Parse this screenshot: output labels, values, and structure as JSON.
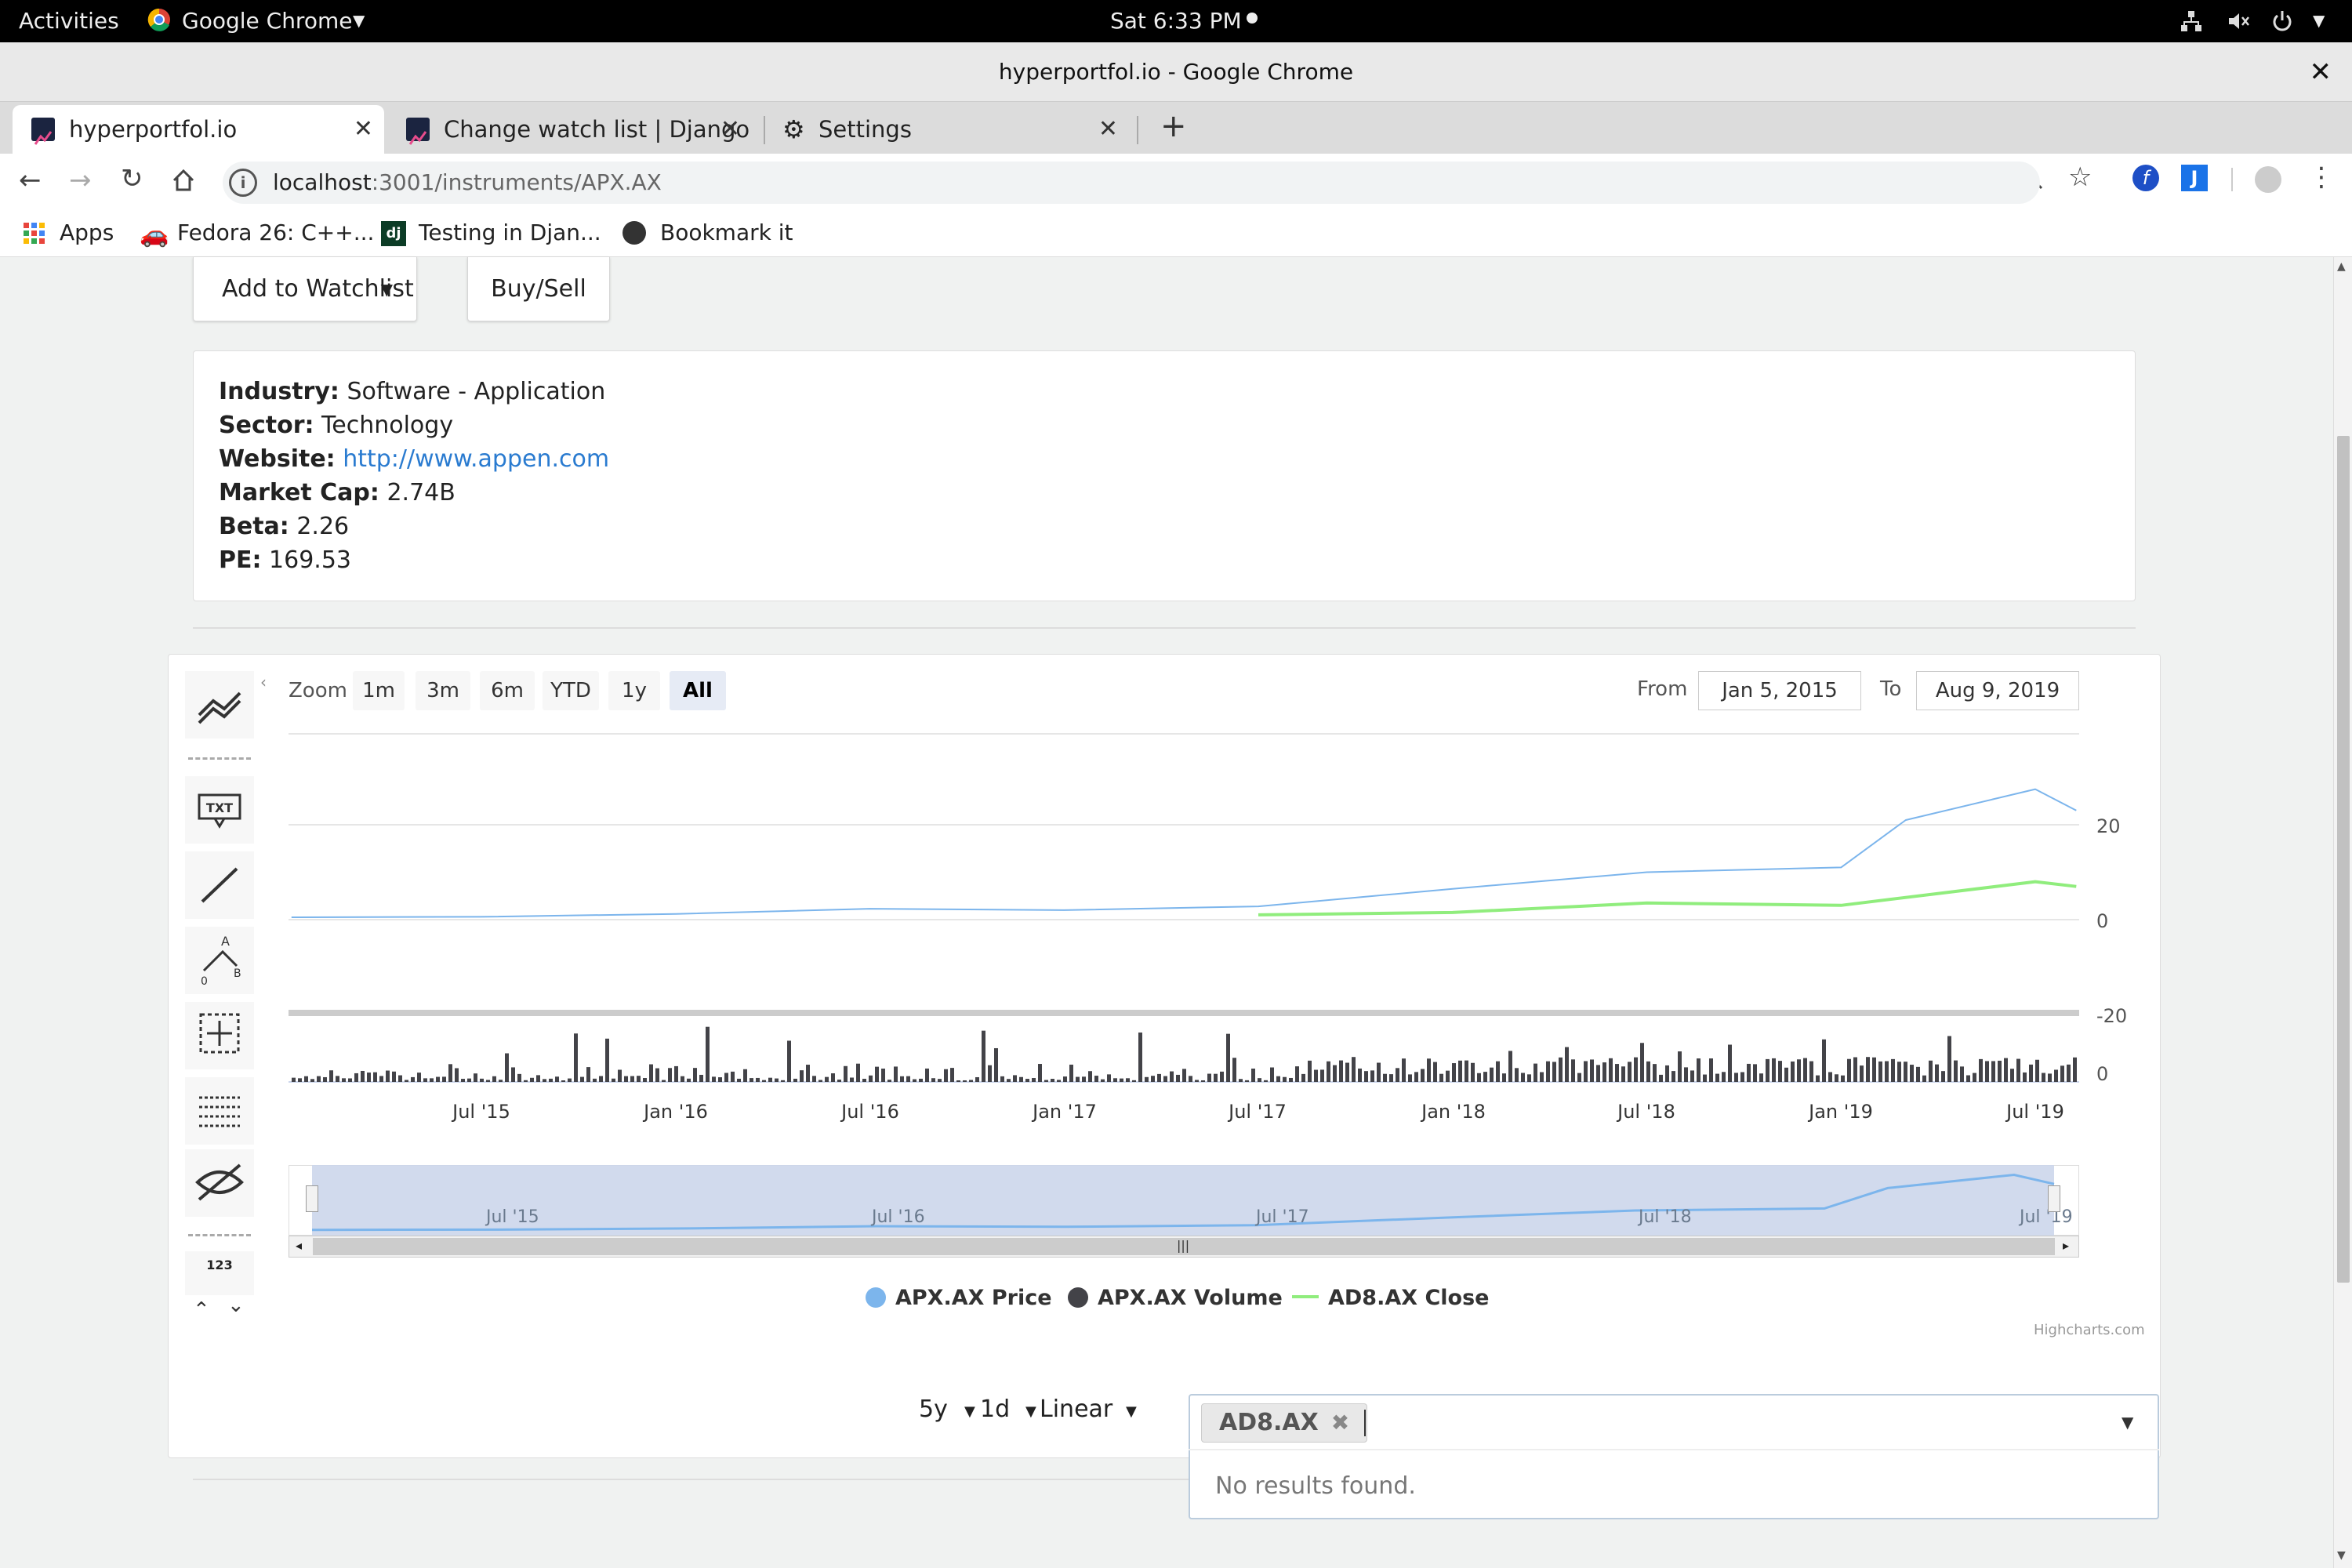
{
  "system_bar": {
    "activities": "Activities",
    "app_name": "Google Chrome",
    "clock": "Sat  6:33 PM"
  },
  "window": {
    "title": "hyperportfol.io - Google Chrome"
  },
  "tabs": [
    {
      "label": "hyperportfol.io"
    },
    {
      "label": "Change watch list | Django"
    },
    {
      "label": "Settings"
    }
  ],
  "address": {
    "host": "localhost",
    "path": ":3001/instruments/APX.AX"
  },
  "bookmarks": [
    {
      "label": "Apps"
    },
    {
      "label": "Fedora 26: C++..."
    },
    {
      "label": "Testing in Djan..."
    },
    {
      "label": "Bookmark it"
    }
  ],
  "actions": {
    "watchlist": "Add to Watchlist",
    "buysell": "Buy/Sell"
  },
  "info": {
    "industry_label": "Industry:",
    "industry": "Software - Application",
    "sector_label": "Sector:",
    "sector": "Technology",
    "website_label": "Website:",
    "website": "http://www.appen.com",
    "marketcap_label": "Market Cap:",
    "marketcap": "2.74B",
    "beta_label": "Beta:",
    "beta": "2.26",
    "pe_label": "PE:",
    "pe": "169.53"
  },
  "chart_ui": {
    "zoom_label": "Zoom",
    "zoom_buttons": [
      "1m",
      "3m",
      "6m",
      "YTD",
      "1y",
      "All"
    ],
    "zoom_selected": "All",
    "from_label": "From",
    "from": "Jan 5, 2015",
    "to_label": "To",
    "to": "Aug 9, 2019",
    "credits": "Highcharts.com",
    "nav_labels": [
      "Jul '15",
      "Jul '16",
      "Jul '17",
      "Jul '18",
      "Jul '19"
    ],
    "tool_counter": "123"
  },
  "controls": {
    "period": "5y",
    "interval": "1d",
    "scale": "Linear",
    "selected_tag": "AD8.AX",
    "no_results": "No results found."
  },
  "chart_data": {
    "type": "line",
    "x_ticks": [
      "Jul '15",
      "Jan '16",
      "Jul '16",
      "Jan '17",
      "Jul '17",
      "Jan '18",
      "Jul '18",
      "Jan '19",
      "Jul '19"
    ],
    "price_axis": {
      "ticks": [
        20,
        0,
        -20
      ]
    },
    "volume_axis": {
      "ticks": [
        0
      ]
    },
    "series": [
      {
        "name": "APX.AX Price",
        "color": "#7cb5ec",
        "x": [
          "Jan 5, 2015",
          "Jul '15",
          "Jan '16",
          "Jul '16",
          "Jan '17",
          "Jul '17",
          "Jan '18",
          "Jul '18",
          "Jan '19",
          "Mar '19",
          "Jul '19",
          "Aug 9, 2019"
        ],
        "values": [
          0.5,
          0.6,
          1.2,
          2.3,
          2.0,
          2.8,
          6.5,
          10.0,
          11.0,
          21.0,
          27.5,
          23.0
        ]
      },
      {
        "name": "AD8.AX Close",
        "color": "#90ed7d",
        "x": [
          "Jul '17",
          "Jan '18",
          "Jul '18",
          "Jan '19",
          "Jul '19",
          "Aug 9, 2019"
        ],
        "values": [
          1.0,
          1.5,
          3.5,
          3.0,
          8.0,
          7.0
        ]
      },
      {
        "name": "APX.AX Volume",
        "color": "#434348",
        "type": "column"
      }
    ]
  },
  "colors": {
    "link": "#2a7bd0",
    "nav_fill": "#ccd6eb",
    "price_line": "#7cb5ec",
    "close_line": "#90ed7d",
    "volume": "#434348"
  }
}
